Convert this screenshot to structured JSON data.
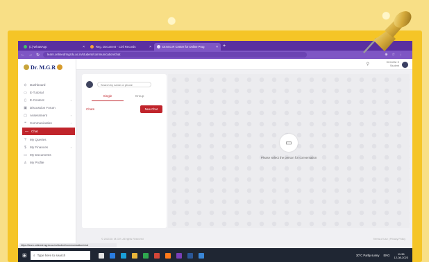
{
  "browser": {
    "tabs": [
      {
        "label": "(1) WhatsApp",
        "active": false
      },
      {
        "label": "Reg. Document - Civil Records",
        "active": false
      },
      {
        "label": "Dr.M.G.R Centre for Online Prog",
        "active": true
      }
    ],
    "url": "learn.onlinedrmgrdu.ac.in/student/communication/chat"
  },
  "sidebar": {
    "logo_text": "Dr. M.G.R",
    "items": [
      {
        "label": "Dashboard",
        "icon": "dashboard-icon",
        "glyph": "⊙",
        "chevron": false
      },
      {
        "label": "E-Tutorial",
        "icon": "monitor-icon",
        "glyph": "▭",
        "chevron": false
      },
      {
        "label": "E-Content",
        "icon": "book-icon",
        "glyph": "▯",
        "chevron": true
      },
      {
        "label": "Discussion Forum",
        "icon": "forum-icon",
        "glyph": "▣",
        "chevron": false
      },
      {
        "label": "Assessment",
        "icon": "clipboard-icon",
        "glyph": "▢",
        "chevron": true
      },
      {
        "label": "Communication",
        "icon": "chat-bubbles-icon",
        "glyph": "❝",
        "chevron": true
      }
    ],
    "active_item": {
      "label": "Chat",
      "icon": "chat-icon",
      "glyph": "—"
    },
    "items_after": [
      {
        "label": "My Queries",
        "icon": "question-icon",
        "glyph": "?",
        "chevron": false
      },
      {
        "label": "My Finances",
        "icon": "wallet-icon",
        "glyph": "$",
        "chevron": true
      },
      {
        "label": "My Documents",
        "icon": "folder-icon",
        "glyph": "▭",
        "chevron": false
      },
      {
        "label": "My Profile",
        "icon": "user-icon",
        "glyph": "♙",
        "chevron": false
      }
    ]
  },
  "header": {
    "user_name": "SHIVANI S",
    "user_role": "Student"
  },
  "chat": {
    "search_placeholder": "Search by name or phone",
    "tabs": [
      "Single",
      "Group"
    ],
    "chats_label": "Chats",
    "new_chat_label": "New Chat",
    "empty_message": "Please select the person for conversation"
  },
  "footer": {
    "left": "© 2023 Dr. M.G.R. All rights Reserved",
    "right": "Terms of Use | Privacy Policy"
  },
  "status_url": "https://learn.onlinedrmgrdu.ac.in/student/communication/chat",
  "taskbar": {
    "search_placeholder": "Type here to search",
    "app_colors": [
      "#e3e3e3",
      "#2a7de1",
      "#1a9fd8",
      "#e8b53a",
      "#2fa84f",
      "#d44638",
      "#ff7a1a",
      "#7a3fb8",
      "#2b5797",
      "#3a86d6"
    ],
    "weather": "30°C Partly sunny",
    "language": "ENG",
    "time": "11:36",
    "date": "12-08-2023"
  },
  "colors": {
    "accent": "#c0242b",
    "browser": "#7e56c4",
    "frame": "#f5c527"
  }
}
